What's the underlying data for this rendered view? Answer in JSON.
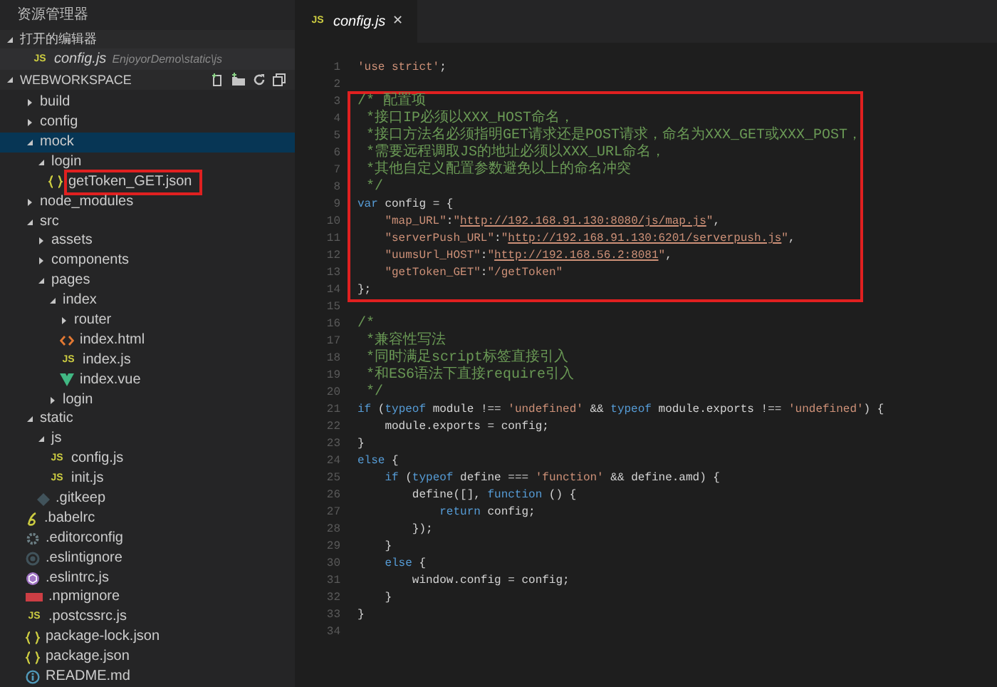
{
  "sidebar": {
    "title": "资源管理器",
    "open_editors": {
      "label": "打开的编辑器",
      "expanded": true,
      "items": [
        {
          "name": "config.js",
          "path": "EnjoyorDemo\\static\\js",
          "kind": "js",
          "badge": "JS"
        }
      ]
    },
    "workspace": {
      "label": "WEBWORKSPACE",
      "expanded": true,
      "tree": [
        {
          "name": "build",
          "kind": "folder",
          "expanded": false,
          "selected": false,
          "highlighted": false
        },
        {
          "name": "config",
          "kind": "folder",
          "expanded": false,
          "selected": false,
          "highlighted": false
        },
        {
          "name": "mock",
          "kind": "folder",
          "expanded": true,
          "selected": true,
          "highlighted": false,
          "children": [
            {
              "name": "login",
              "kind": "folder",
              "expanded": true,
              "selected": false,
              "highlighted": false,
              "children": [
                {
                  "name": "getToken_GET.json",
                  "kind": "json",
                  "selected": false,
                  "highlighted": true
                }
              ]
            }
          ]
        },
        {
          "name": "node_modules",
          "kind": "folder",
          "expanded": false,
          "selected": false,
          "highlighted": false
        },
        {
          "name": "src",
          "kind": "folder",
          "expanded": true,
          "selected": false,
          "highlighted": false,
          "children": [
            {
              "name": "assets",
              "kind": "folder",
              "expanded": false,
              "selected": false,
              "highlighted": false
            },
            {
              "name": "components",
              "kind": "folder",
              "expanded": false,
              "selected": false,
              "highlighted": false
            },
            {
              "name": "pages",
              "kind": "folder",
              "expanded": true,
              "selected": false,
              "highlighted": false,
              "children": [
                {
                  "name": "index",
                  "kind": "folder",
                  "expanded": true,
                  "selected": false,
                  "highlighted": false,
                  "children": [
                    {
                      "name": "router",
                      "kind": "folder",
                      "expanded": false,
                      "selected": false,
                      "highlighted": false
                    },
                    {
                      "name": "index.html",
                      "kind": "html",
                      "selected": false,
                      "highlighted": false
                    },
                    {
                      "name": "index.js",
                      "kind": "js",
                      "badge": "JS",
                      "selected": false,
                      "highlighted": false
                    },
                    {
                      "name": "index.vue",
                      "kind": "vue",
                      "selected": false,
                      "highlighted": false
                    }
                  ]
                },
                {
                  "name": "login",
                  "kind": "folder",
                  "expanded": false,
                  "selected": false,
                  "highlighted": false
                }
              ]
            }
          ]
        },
        {
          "name": "static",
          "kind": "folder",
          "expanded": true,
          "selected": false,
          "highlighted": false,
          "children": [
            {
              "name": "js",
              "kind": "folder",
              "expanded": true,
              "selected": false,
              "highlighted": false,
              "children": [
                {
                  "name": "config.js",
                  "kind": "js",
                  "badge": "JS",
                  "selected": false,
                  "highlighted": false
                },
                {
                  "name": "init.js",
                  "kind": "js",
                  "badge": "JS",
                  "selected": false,
                  "highlighted": false
                }
              ]
            },
            {
              "name": ".gitkeep",
              "kind": "gitkeep",
              "selected": false,
              "highlighted": false
            }
          ]
        },
        {
          "name": ".babelrc",
          "kind": "babel",
          "selected": false,
          "highlighted": false
        },
        {
          "name": ".editorconfig",
          "kind": "editorconfig",
          "selected": false,
          "highlighted": false
        },
        {
          "name": ".eslintignore",
          "kind": "eslintignore",
          "selected": false,
          "highlighted": false
        },
        {
          "name": ".eslintrc.js",
          "kind": "eslintrc",
          "selected": false,
          "highlighted": false
        },
        {
          "name": ".npmignore",
          "kind": "npmignore",
          "selected": false,
          "highlighted": false
        },
        {
          "name": ".postcssrc.js",
          "kind": "js",
          "badge": "JS",
          "selected": false,
          "highlighted": false
        },
        {
          "name": "package-lock.json",
          "kind": "json",
          "selected": false,
          "highlighted": false
        },
        {
          "name": "package.json",
          "kind": "json",
          "selected": false,
          "highlighted": false
        },
        {
          "name": "README.md",
          "kind": "readme",
          "selected": false,
          "highlighted": false
        }
      ]
    }
  },
  "tabs": [
    {
      "label": "config.js",
      "kind": "js",
      "badge": "JS",
      "close": "✕",
      "selected": true
    }
  ],
  "code": {
    "blocks": [
      {
        "highlighted": false,
        "lines": [
          {
            "number": "1",
            "tokens": [
              {
                "kind": "s",
                "text": "'use strict'"
              },
              {
                "kind": "p",
                "text": ";"
              }
            ]
          },
          {
            "number": "2"
          }
        ]
      },
      {
        "highlighted": true,
        "lines": [
          {
            "number": "3",
            "tokens": [
              {
                "kind": "c",
                "text": "/* 配置项"
              }
            ]
          },
          {
            "number": "4",
            "tokens": [
              {
                "kind": "c",
                "text": " *接口IP必须以XXX_HOST命名，"
              }
            ]
          },
          {
            "number": "5",
            "tokens": [
              {
                "kind": "c",
                "text": " *接口方法名必须指明GET请求还是POST请求，命名为XXX_GET或XXX_POST，"
              }
            ]
          },
          {
            "number": "6",
            "tokens": [
              {
                "kind": "c",
                "text": " *需要远程调取JS的地址必须以XXX_URL命名，"
              }
            ]
          },
          {
            "number": "7",
            "tokens": [
              {
                "kind": "c",
                "text": " *其他自定义配置参数避免以上的命名冲突"
              }
            ]
          },
          {
            "number": "8",
            "tokens": [
              {
                "kind": "c",
                "text": " */"
              }
            ]
          },
          {
            "number": "9",
            "tokens": [
              {
                "kind": "k",
                "text": "var"
              },
              {
                "kind": "p",
                "text": " config = {"
              }
            ]
          },
          {
            "number": "10",
            "tokens": [
              {
                "kind": "s",
                "text": "    \"map_URL\""
              },
              {
                "kind": "p",
                "text": ":"
              },
              {
                "kind": "s",
                "text": "\""
              },
              {
                "kind": "u",
                "text": "http://192.168.91.130:8080/js/map.js"
              },
              {
                "kind": "s",
                "text": "\""
              },
              {
                "kind": "p",
                "text": ","
              }
            ]
          },
          {
            "number": "11",
            "tokens": [
              {
                "kind": "s",
                "text": "    \"serverPush_URL\""
              },
              {
                "kind": "p",
                "text": ":"
              },
              {
                "kind": "s",
                "text": "\""
              },
              {
                "kind": "u",
                "text": "http://192.168.91.130:6201/serverpush.js"
              },
              {
                "kind": "s",
                "text": "\""
              },
              {
                "kind": "p",
                "text": ","
              }
            ]
          },
          {
            "number": "12",
            "tokens": [
              {
                "kind": "s",
                "text": "    \"uumsUrl_HOST\""
              },
              {
                "kind": "p",
                "text": ":"
              },
              {
                "kind": "s",
                "text": "\""
              },
              {
                "kind": "u",
                "text": "http://192.168.56.2:8081"
              },
              {
                "kind": "s",
                "text": "\""
              },
              {
                "kind": "p",
                "text": ","
              }
            ]
          },
          {
            "number": "13",
            "tokens": [
              {
                "kind": "s",
                "text": "    \"getToken_GET\""
              },
              {
                "kind": "p",
                "text": ":"
              },
              {
                "kind": "s",
                "text": "\"/getToken\""
              }
            ]
          },
          {
            "number": "14",
            "tokens": [
              {
                "kind": "p",
                "text": "};"
              }
            ]
          }
        ]
      },
      {
        "highlighted": false,
        "lines": [
          {
            "number": "15"
          },
          {
            "number": "16",
            "tokens": [
              {
                "kind": "c",
                "text": "/*"
              }
            ]
          },
          {
            "number": "17",
            "tokens": [
              {
                "kind": "c",
                "text": " *兼容性写法"
              }
            ]
          },
          {
            "number": "18",
            "tokens": [
              {
                "kind": "c",
                "text": " *同时满足script标签直接引入"
              }
            ]
          },
          {
            "number": "19",
            "tokens": [
              {
                "kind": "c",
                "text": " *和ES6语法下直接require引入"
              }
            ]
          },
          {
            "number": "20",
            "tokens": [
              {
                "kind": "c",
                "text": " */"
              }
            ]
          },
          {
            "number": "21",
            "tokens": [
              {
                "kind": "k",
                "text": "if"
              },
              {
                "kind": "p",
                "text": " ("
              },
              {
                "kind": "k",
                "text": "typeof"
              },
              {
                "kind": "p",
                "text": " module !== "
              },
              {
                "kind": "s",
                "text": "'undefined'"
              },
              {
                "kind": "p",
                "text": " && "
              },
              {
                "kind": "k",
                "text": "typeof"
              },
              {
                "kind": "p",
                "text": " module.exports !== "
              },
              {
                "kind": "s",
                "text": "'undefined'"
              },
              {
                "kind": "p",
                "text": ") {"
              }
            ]
          },
          {
            "number": "22",
            "tokens": [
              {
                "kind": "p",
                "text": "    module.exports = config;"
              }
            ]
          },
          {
            "number": "23",
            "tokens": [
              {
                "kind": "p",
                "text": "}"
              }
            ]
          },
          {
            "number": "24",
            "tokens": [
              {
                "kind": "k",
                "text": "else"
              },
              {
                "kind": "p",
                "text": " {"
              }
            ]
          },
          {
            "number": "25",
            "tokens": [
              {
                "kind": "k",
                "text": "    if"
              },
              {
                "kind": "p",
                "text": " ("
              },
              {
                "kind": "k",
                "text": "typeof"
              },
              {
                "kind": "p",
                "text": " define === "
              },
              {
                "kind": "s",
                "text": "'function'"
              },
              {
                "kind": "p",
                "text": " && define.amd) {"
              }
            ]
          },
          {
            "number": "26",
            "tokens": [
              {
                "kind": "p",
                "text": "        define([], "
              },
              {
                "kind": "k",
                "text": "function"
              },
              {
                "kind": "p",
                "text": " () {"
              }
            ]
          },
          {
            "number": "27",
            "tokens": [
              {
                "kind": "k",
                "text": "            return"
              },
              {
                "kind": "p",
                "text": " config;"
              }
            ]
          },
          {
            "number": "28",
            "tokens": [
              {
                "kind": "p",
                "text": "        });"
              }
            ]
          },
          {
            "number": "29",
            "tokens": [
              {
                "kind": "p",
                "text": "    }"
              }
            ]
          },
          {
            "number": "30",
            "tokens": [
              {
                "kind": "k",
                "text": "    else"
              },
              {
                "kind": "p",
                "text": " {"
              }
            ]
          },
          {
            "number": "31",
            "tokens": [
              {
                "kind": "p",
                "text": "        window.config = config;"
              }
            ]
          },
          {
            "number": "32",
            "tokens": [
              {
                "kind": "p",
                "text": "    }"
              }
            ]
          },
          {
            "number": "33",
            "tokens": [
              {
                "kind": "p",
                "text": "}"
              }
            ]
          },
          {
            "number": "34"
          }
        ]
      }
    ]
  }
}
